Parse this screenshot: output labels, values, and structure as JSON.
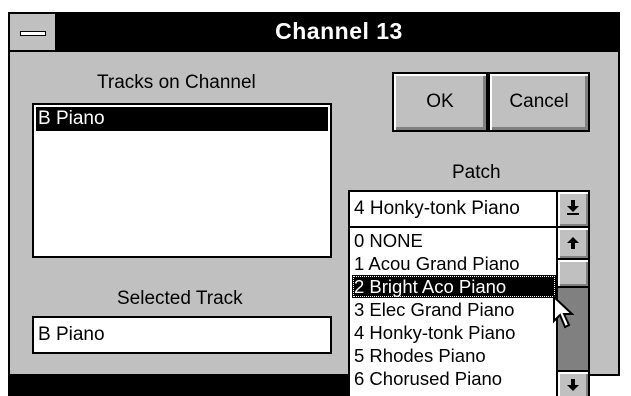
{
  "window": {
    "title": "Channel 13"
  },
  "labels": {
    "tracks_on_channel": "Tracks on Channel",
    "selected_track": "Selected Track",
    "patch": "Patch"
  },
  "tracks": {
    "items": [
      "B Piano"
    ],
    "selected_index": 0
  },
  "selected_track_value": "B Piano",
  "buttons": {
    "ok": "OK",
    "cancel": "Cancel"
  },
  "patch": {
    "current": "4  Honky-tonk Piano",
    "options": [
      "0  NONE",
      "1  Acou Grand Piano",
      "2  Bright Aco Piano",
      "3  Elec Grand Piano",
      "4  Honky-tonk Piano",
      "5  Rhodes Piano",
      "6  Chorused Piano"
    ],
    "highlighted_index": 2
  },
  "icons": [
    "system-menu-icon",
    "combo-dropdown-arrow-icon",
    "scroll-up-arrow-icon",
    "scroll-down-arrow-icon",
    "mouse-pointer-icon"
  ]
}
